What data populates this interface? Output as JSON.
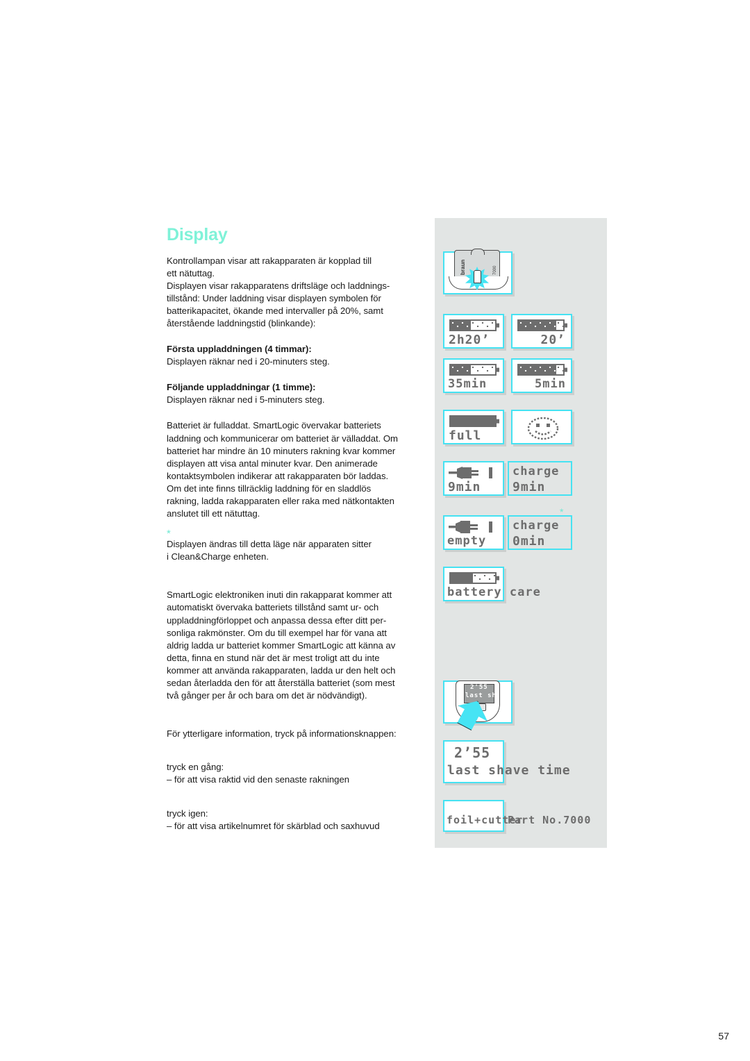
{
  "page": {
    "title": "Display",
    "number": "57"
  },
  "body": {
    "intro": [
      "Kontrollampan visar att rakapparaten är kopplad till",
      "ett nätuttag.",
      "Displayen visar rakapparatens driftsläge och laddnings-",
      "tillstånd: Under laddning visar displayen symbolen för",
      "batterikapacitet, ökande med intervaller på 20%, samt",
      "återstående laddningstid (blinkande):"
    ],
    "heading_first_charge": "Första uppladdningen (4 timmar):",
    "first_charge_text": "Displayen räknar ned i 20-minuters steg.",
    "heading_following_charges": "Följande uppladdningar (1 timme):",
    "following_charges_text": "Displayen räknar ned i 5-minuters steg.",
    "smartlogic_block": [
      "Batteriet är fulladdat. SmartLogic övervakar batteriets",
      "laddning och kommunicerar om batteriet är välladdat. Om",
      "batteriet har mindre än 10 minuters rakning kvar kommer",
      "displayen att visa antal minuter kvar. Den animerade",
      "kontaktsymbolen indikerar att rakapparaten bör laddas.",
      "Om det inte finns tillräcklig laddning för en sladdlös",
      "rakning, ladda rakapparaten eller raka med nätkontakten",
      "anslutet till ett nätuttag."
    ],
    "footnote_marker": "*",
    "footnote_block": [
      "Displayen ändras till detta läge när apparaten sitter",
      "i Clean&Charge enheten."
    ],
    "smartlogic_long_block": [
      "SmartLogic elektroniken inuti din rakapparat kommer att",
      "automatiskt övervaka batteriets tillstånd samt ur- och",
      "uppladdningförloppet och anpassa dessa efter ditt per-",
      "sonliga rakmönster. Om du till exempel har för vana att",
      "aldrig ladda ur batteriet kommer SmartLogic att känna av",
      "detta, finna en stund när det är mest troligt att du inte",
      "kommer att använda rakapparaten, ladda ur den helt och",
      "sedan återladda den för att återställa batteriet (som mest",
      "två gånger per år och bara om det är nödvändigt)."
    ],
    "info_button_line": "För ytterligare information, tryck på informationsknappen:",
    "press_once_label": "tryck en gång:",
    "press_once_desc": "– för att visa raktid vid den senaste rakningen",
    "press_again_label": "tryck igen:",
    "press_again_desc": "– för att visa artikelnumret för skärblad och saxhuvud"
  },
  "figures": {
    "shaver_top": {
      "brand": "braun",
      "model": "7000",
      "indicator": "charging-light-starburst"
    },
    "lcd_panels": [
      {
        "id": "charge-2h20",
        "battery_fill_percent": 45,
        "text": "2h20’"
      },
      {
        "id": "charge-20",
        "battery_fill_percent": 85,
        "text": "20’"
      },
      {
        "id": "charge-35min",
        "battery_fill_percent": 45,
        "text": "35min"
      },
      {
        "id": "charge-5min",
        "battery_fill_percent": 85,
        "text": "5min"
      },
      {
        "id": "full",
        "battery_fill_percent": 100,
        "text": "full"
      },
      {
        "id": "smiley",
        "icon": "smiley-face-icon"
      },
      {
        "id": "plug-9min",
        "icon": "plug-icon",
        "text": "9min"
      },
      {
        "id": "charge-9min",
        "line1": "charge",
        "line2": "9min"
      },
      {
        "id": "plug-empty",
        "icon": "plug-icon",
        "text": "empty"
      },
      {
        "id": "charge-0min",
        "line1": "charge",
        "line2": "0min"
      },
      {
        "id": "battery-care",
        "battery_fill_percent": 50,
        "text": "battery care"
      }
    ],
    "footnote_star": "*",
    "shaver_info": {
      "display_line1": "2'55",
      "display_line2": "last sh",
      "arrow": "up-arrow-pointing-to-info-button"
    },
    "last_shave": {
      "time": "2’55",
      "label": "last shave time"
    },
    "part_number": {
      "left": "foil+cutter",
      "right": "Part No.7000"
    }
  },
  "colors": {
    "accent_title": "#7FF2D8",
    "panel_border": "#45E2F2",
    "panel_background": "#e2e5e4",
    "lcd_text": "#6d6d6d"
  }
}
